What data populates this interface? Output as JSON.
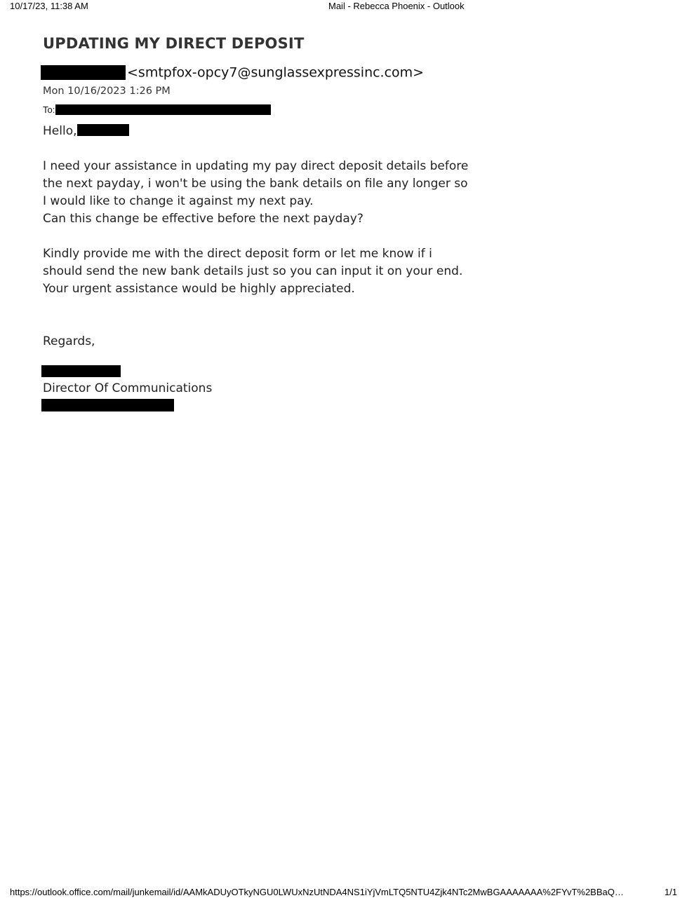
{
  "print_header": {
    "datetime": "10/17/23, 11:38 AM",
    "title": "Mail - Rebecca Phoenix - Outlook"
  },
  "email": {
    "subject": "UPDATING MY DIRECT DEPOSIT",
    "sender_email": "<smtpfox-opcy7@sunglassexpressinc.com>",
    "date": "Mon 10/16/2023 1:26 PM",
    "to_label": "To:",
    "greeting": "Hello,",
    "body_paragraph_1": [
      "I need your assistance in updating my pay direct deposit details before",
      "the next payday, i won't be using the bank details on file any longer so",
      "I would like to change it against my next pay.",
      "Can this change be effective before the next payday?"
    ],
    "body_paragraph_2": [
      "Kindly provide me with the direct deposit form or let me know if i",
      "should send the new bank details just so you can input it on your end.",
      "Your urgent assistance would be highly appreciated."
    ],
    "closing": "Regards,",
    "signature_title": "Director Of Communications"
  },
  "print_footer": {
    "url": "https://outlook.office.com/mail/junkemail/id/AAMkADUyOTkyNGU0LWUxNzUtNDA4NS1iYjVmLTQ5NTU4Zjk4NTc2MwBGAAAAAAA%2FYvT%2BBaQ…",
    "page": "1/1"
  }
}
